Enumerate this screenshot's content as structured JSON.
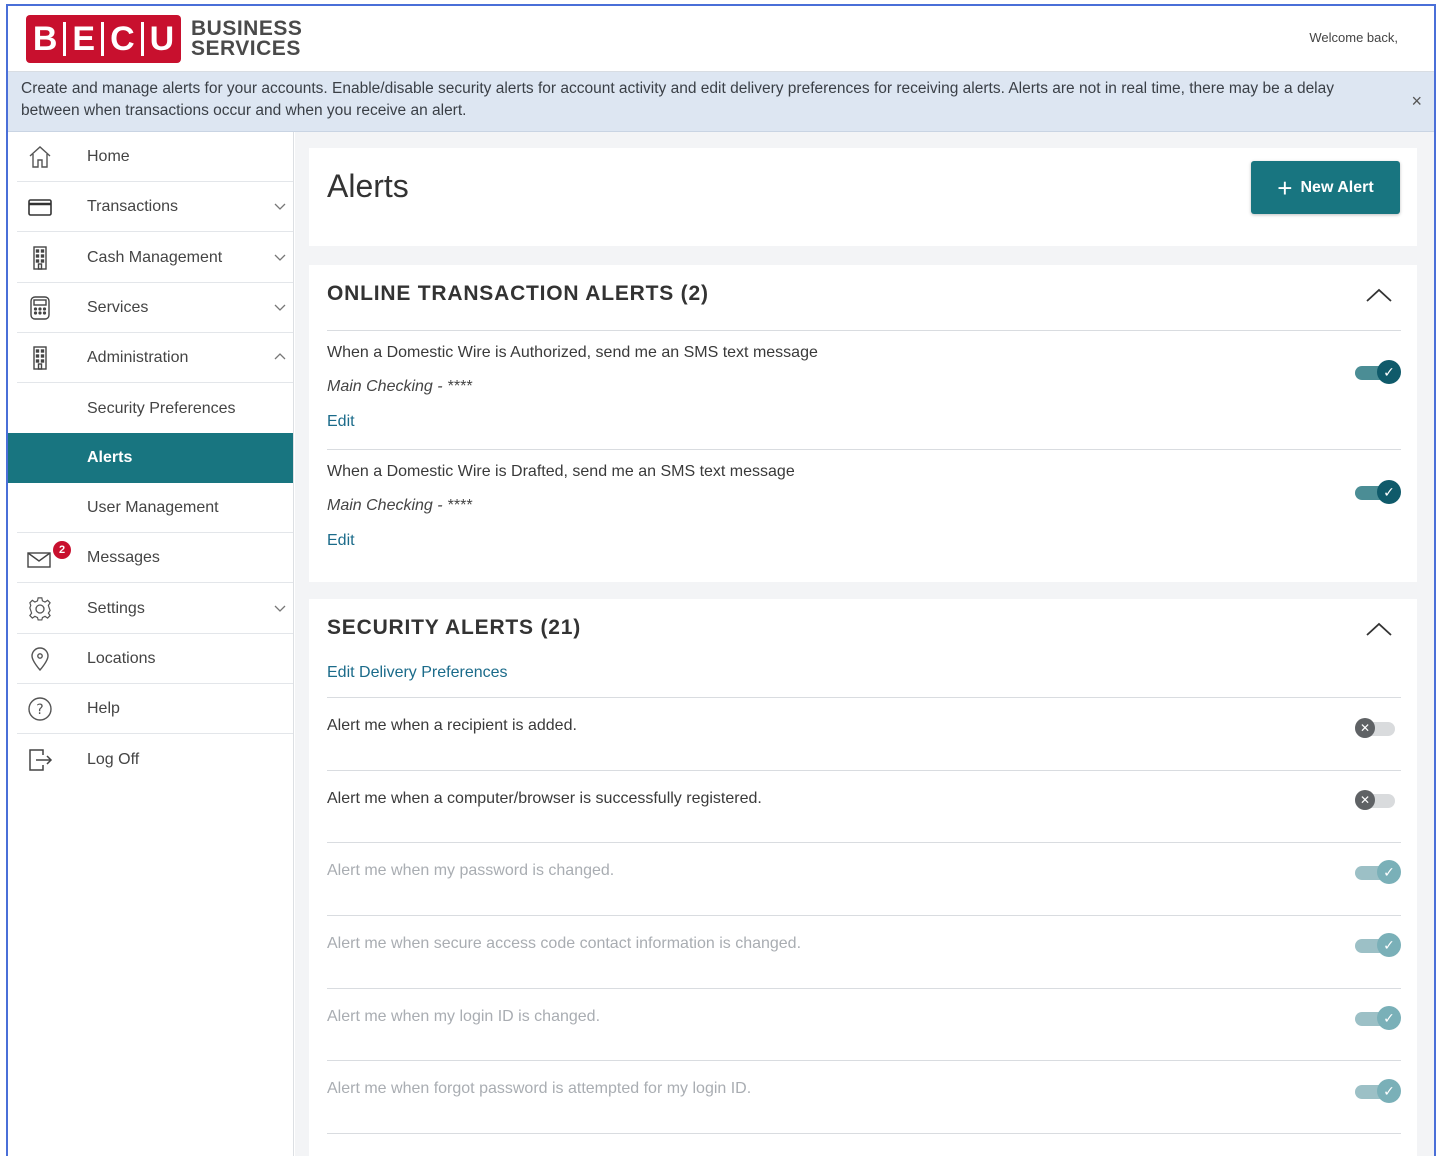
{
  "brand": {
    "logo_letters": [
      "B",
      "E",
      "C",
      "U"
    ],
    "logo_line1": "BUSINESS",
    "logo_line2": "SERVICES",
    "primary_color": "#c8102e",
    "accent_color": "#187580"
  },
  "header": {
    "welcome": "Welcome back,"
  },
  "banner": {
    "text": "Create and manage alerts for your accounts. Enable/disable security alerts for account activity and edit delivery preferences for receiving alerts. Alerts are not in real time, there may be a delay between when transactions occur and when you receive an alert.",
    "close_icon": "×"
  },
  "sidebar": {
    "items": [
      {
        "label": "Home",
        "icon": "home-icon"
      },
      {
        "label": "Transactions",
        "icon": "card-icon",
        "chevron": "down"
      },
      {
        "label": "Cash Management",
        "icon": "building-icon",
        "chevron": "down"
      },
      {
        "label": "Services",
        "icon": "calculator-icon",
        "chevron": "down"
      },
      {
        "label": "Administration",
        "icon": "building-icon",
        "chevron": "up"
      },
      {
        "label": "Security Preferences"
      },
      {
        "label": "Alerts",
        "active": true
      },
      {
        "label": "User Management"
      },
      {
        "label": "Messages",
        "icon": "mail-icon",
        "badge": "2"
      },
      {
        "label": "Settings",
        "icon": "gear-icon",
        "chevron": "down"
      },
      {
        "label": "Locations",
        "icon": "location-pin-icon"
      },
      {
        "label": "Help",
        "icon": "help-icon"
      },
      {
        "label": "Log Off",
        "icon": "logout-icon"
      }
    ]
  },
  "page": {
    "title": "Alerts",
    "new_alert_button": "New Alert"
  },
  "online_alerts": {
    "title": "ONLINE TRANSACTION ALERTS (2)",
    "items": [
      {
        "text": "When a Domestic Wire is Authorized, send me an SMS text message",
        "account": "Main Checking - ****",
        "edit": "Edit",
        "enabled": true
      },
      {
        "text": "When a Domestic Wire is Drafted, send me an SMS text message",
        "account": "Main Checking - ****",
        "edit": "Edit",
        "enabled": true
      }
    ]
  },
  "security_alerts": {
    "title": "SECURITY ALERTS (21)",
    "edit_delivery": "Edit Delivery Preferences",
    "items": [
      {
        "text": "Alert me when a recipient is added.",
        "state": "off"
      },
      {
        "text": "Alert me when a computer/browser is successfully registered.",
        "state": "off"
      },
      {
        "text": "Alert me when my password is changed.",
        "state": "locked-on"
      },
      {
        "text": "Alert me when secure access code contact information is changed.",
        "state": "locked-on"
      },
      {
        "text": "Alert me when my login ID is changed.",
        "state": "locked-on"
      },
      {
        "text": "Alert me when forgot password is attempted for my login ID.",
        "state": "locked-on"
      }
    ]
  }
}
